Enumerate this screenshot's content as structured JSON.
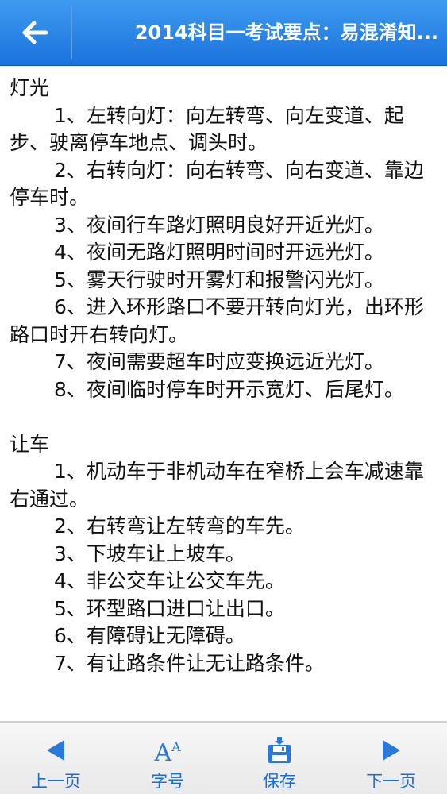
{
  "header": {
    "back_icon": "back-arrow-icon",
    "title": "2014科目一考试要点：易混淆知..."
  },
  "content": {
    "sections": [
      {
        "title": "灯光",
        "items": [
          "1、左转向灯：向左转弯、向左变道、起步、驶离停车地点、调头时。",
          "2、右转向灯：向右转弯、向右变道、靠边停车时。",
          "3、夜间行车路灯照明良好开近光灯。",
          "4、夜间无路灯照明时间时开远光灯。",
          "5、雾天行驶时开雾灯和报警闪光灯。",
          "6、进入环形路口不要开转向灯光，出环形路口时开右转向灯。",
          "7、夜间需要超车时应变换远近光灯。",
          "8、夜间临时停车时开示宽灯、后尾灯。"
        ]
      },
      {
        "title": "让车",
        "items": [
          "1、机动车于非机动车在窄桥上会车减速靠右通过。",
          "2、右转弯让左转弯的车先。",
          "3、下坡车让上坡车。",
          "4、非公交车让公交车先。",
          "5、环型路口进口让出口。",
          "6、有障碍让无障碍。",
          "7、有让路条件让无让路条件。"
        ]
      }
    ]
  },
  "footer": {
    "prev_label": "上一页",
    "prev_icon": "left-triangle-icon",
    "font_label": "字号",
    "font_icon": "font-size-icon",
    "font_icon_text": "A",
    "font_icon_sup": "A",
    "save_label": "保存",
    "save_icon": "floppy-disk-icon",
    "next_label": "下一页",
    "next_icon": "right-triangle-icon"
  },
  "colors": {
    "header_top": "#3f9bf0",
    "header_bottom": "#1a72dd",
    "accent": "#1a6fd6",
    "text": "#111111"
  }
}
